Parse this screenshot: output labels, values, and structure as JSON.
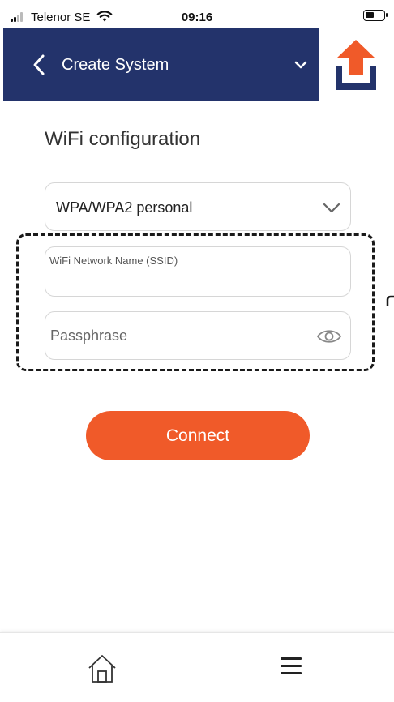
{
  "status_bar": {
    "carrier": "Telenor SE",
    "time": "09:16"
  },
  "header": {
    "title": "Create System",
    "back_icon": "chevron-left-icon",
    "dropdown_icon": "chevron-down-icon",
    "logo_icon": "upload-arrow-logo",
    "background_color": "#23336b"
  },
  "page": {
    "title": "WiFi configuration"
  },
  "form": {
    "security_type": {
      "value": "WPA/WPA2 personal",
      "icon": "chevron-down-icon"
    },
    "ssid": {
      "label": "WiFi Network Name (SSID)",
      "value": ""
    },
    "passphrase": {
      "placeholder": "Passphrase",
      "icon": "eye-icon"
    },
    "connect_label": "Connect",
    "connect_color": "#f05a29"
  },
  "bottom_nav": {
    "items": [
      {
        "icon": "home-icon"
      },
      {
        "icon": "menu-icon"
      }
    ]
  }
}
